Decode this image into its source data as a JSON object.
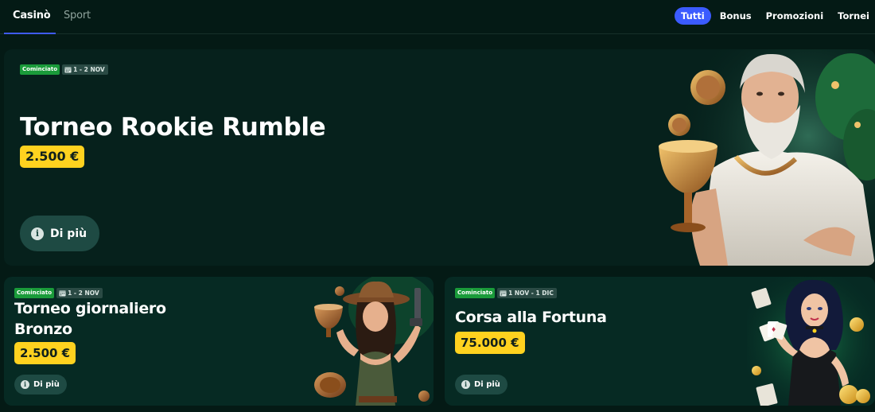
{
  "nav": {
    "vertical_tabs": [
      {
        "label": "Casinò",
        "active": true
      },
      {
        "label": "Sport",
        "active": false
      }
    ],
    "filters": [
      {
        "label": "Tutti",
        "active": true
      },
      {
        "label": "Bonus",
        "active": false
      },
      {
        "label": "Promozioni",
        "active": false
      },
      {
        "label": "Tornei",
        "active": false
      }
    ]
  },
  "colors": {
    "background": "#041a15",
    "card": "#062a23",
    "accent_blue": "#3b5bff",
    "prize_yellow": "#ffd21f",
    "started_green": "#1a9b3a"
  },
  "hero": {
    "status": "Cominciato",
    "dates": "1 - 2 NOV",
    "title": "Torneo Rookie Rumble",
    "prize": "2.500 €",
    "more_label": "Di più",
    "icons": [
      "calendar-icon",
      "info-icon"
    ]
  },
  "cards": [
    {
      "status": "Cominciato",
      "dates": "1 - 2 NOV",
      "title": "Torneo giornaliero Bronzo",
      "prize": "2.500 €",
      "more_label": "Di più"
    },
    {
      "status": "Cominciato",
      "dates": "1 NOV - 1 DIC",
      "title": "Corsa alla Fortuna",
      "prize": "75.000 €",
      "more_label": "Di più"
    }
  ]
}
